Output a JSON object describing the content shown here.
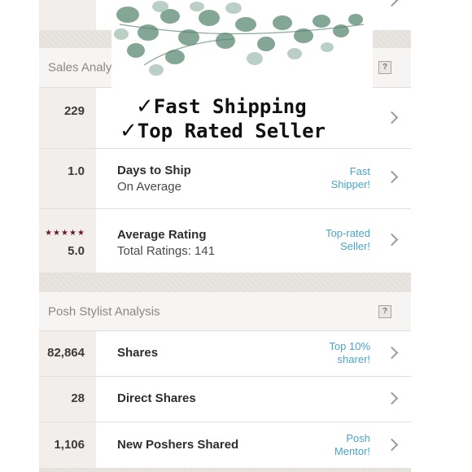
{
  "sales": {
    "title": "Sales Analysis",
    "help_label": "?",
    "rows": [
      {
        "value": "229",
        "label": "",
        "sub": "",
        "badge_line1": "",
        "badge_line2": ""
      },
      {
        "value": "1.0",
        "label": "Days to Ship",
        "sub": "On Average",
        "badge_line1": "Fast",
        "badge_line2": "Shipper!"
      },
      {
        "value": "5.0",
        "stars": "★★★★★",
        "label": "Average Rating",
        "sub": "Total Ratings: 141",
        "badge_line1": "Top-rated",
        "badge_line2": "Seller!"
      }
    ]
  },
  "stylist": {
    "title": "Posh Stylist Analysis",
    "help_label": "?",
    "rows": [
      {
        "value": "82,864",
        "label": "Shares",
        "badge_line1": "Top 10%",
        "badge_line2": "sharer!"
      },
      {
        "value": "28",
        "label": "Direct Shares",
        "badge_line1": "",
        "badge_line2": ""
      },
      {
        "value": "1,106",
        "label": "New Poshers Shared",
        "badge_line1": "Posh",
        "badge_line2": "Mentor!"
      }
    ]
  },
  "overlay": {
    "check_mark": "✓",
    "line1": "Fast Shipping",
    "line2": "Top Rated Seller"
  },
  "colors": {
    "badge_text": "#4aa5c6",
    "star_color": "#6b1a27",
    "leaf_dark": "#4f7763",
    "leaf_light": "#8fb0a1"
  }
}
